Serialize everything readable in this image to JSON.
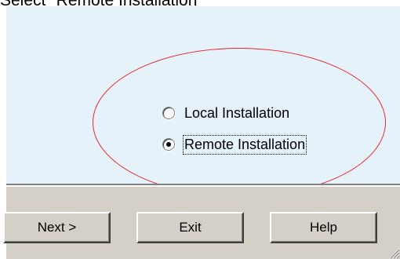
{
  "caption": "Select \"Remote Installation\"",
  "options": [
    {
      "label": "Local Installation",
      "selected": false
    },
    {
      "label": "Remote Installation",
      "selected": true
    }
  ],
  "buttons": {
    "next": "Next >",
    "exit": "Exit",
    "help": "Help"
  },
  "colors": {
    "panel_bg": "#e6f2fa",
    "dialog_bg": "#d4d0c8",
    "highlight_ellipse": "#e8242c"
  },
  "icons": [
    "radio-unchecked-icon",
    "radio-checked-icon",
    "resize-grip-icon"
  ]
}
